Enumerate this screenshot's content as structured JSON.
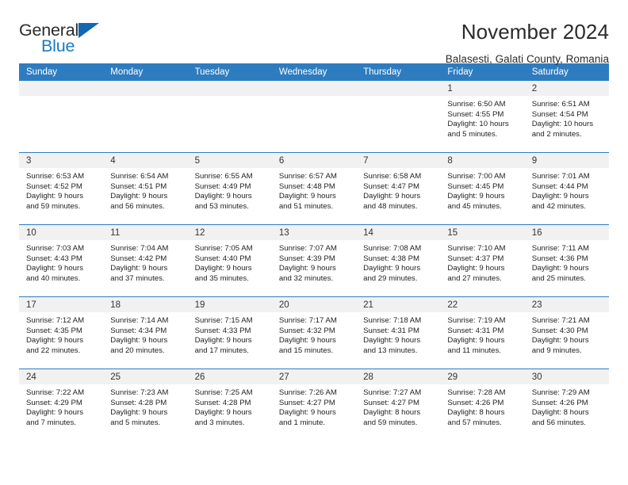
{
  "brand": {
    "name_top": "General",
    "name_bottom": "Blue",
    "accent_color": "#1167b1",
    "blue_text_color": "#1a7ac4"
  },
  "header": {
    "title": "November 2024",
    "subtitle": "Balasesti, Galati County, Romania"
  },
  "calendar": {
    "header_bg": "#2e7cc0",
    "daynum_bg": "#f1f1f1",
    "weekday_headers": [
      "Sunday",
      "Monday",
      "Tuesday",
      "Wednesday",
      "Thursday",
      "Friday",
      "Saturday"
    ],
    "weeks": [
      [
        {
          "day": "",
          "empty": true
        },
        {
          "day": "",
          "empty": true
        },
        {
          "day": "",
          "empty": true
        },
        {
          "day": "",
          "empty": true
        },
        {
          "day": "",
          "empty": true
        },
        {
          "day": "1",
          "sunrise": "Sunrise: 6:50 AM",
          "sunset": "Sunset: 4:55 PM",
          "daylight_1": "Daylight: 10 hours",
          "daylight_2": "and 5 minutes."
        },
        {
          "day": "2",
          "sunrise": "Sunrise: 6:51 AM",
          "sunset": "Sunset: 4:54 PM",
          "daylight_1": "Daylight: 10 hours",
          "daylight_2": "and 2 minutes."
        }
      ],
      [
        {
          "day": "3",
          "sunrise": "Sunrise: 6:53 AM",
          "sunset": "Sunset: 4:52 PM",
          "daylight_1": "Daylight: 9 hours",
          "daylight_2": "and 59 minutes."
        },
        {
          "day": "4",
          "sunrise": "Sunrise: 6:54 AM",
          "sunset": "Sunset: 4:51 PM",
          "daylight_1": "Daylight: 9 hours",
          "daylight_2": "and 56 minutes."
        },
        {
          "day": "5",
          "sunrise": "Sunrise: 6:55 AM",
          "sunset": "Sunset: 4:49 PM",
          "daylight_1": "Daylight: 9 hours",
          "daylight_2": "and 53 minutes."
        },
        {
          "day": "6",
          "sunrise": "Sunrise: 6:57 AM",
          "sunset": "Sunset: 4:48 PM",
          "daylight_1": "Daylight: 9 hours",
          "daylight_2": "and 51 minutes."
        },
        {
          "day": "7",
          "sunrise": "Sunrise: 6:58 AM",
          "sunset": "Sunset: 4:47 PM",
          "daylight_1": "Daylight: 9 hours",
          "daylight_2": "and 48 minutes."
        },
        {
          "day": "8",
          "sunrise": "Sunrise: 7:00 AM",
          "sunset": "Sunset: 4:45 PM",
          "daylight_1": "Daylight: 9 hours",
          "daylight_2": "and 45 minutes."
        },
        {
          "day": "9",
          "sunrise": "Sunrise: 7:01 AM",
          "sunset": "Sunset: 4:44 PM",
          "daylight_1": "Daylight: 9 hours",
          "daylight_2": "and 42 minutes."
        }
      ],
      [
        {
          "day": "10",
          "sunrise": "Sunrise: 7:03 AM",
          "sunset": "Sunset: 4:43 PM",
          "daylight_1": "Daylight: 9 hours",
          "daylight_2": "and 40 minutes."
        },
        {
          "day": "11",
          "sunrise": "Sunrise: 7:04 AM",
          "sunset": "Sunset: 4:42 PM",
          "daylight_1": "Daylight: 9 hours",
          "daylight_2": "and 37 minutes."
        },
        {
          "day": "12",
          "sunrise": "Sunrise: 7:05 AM",
          "sunset": "Sunset: 4:40 PM",
          "daylight_1": "Daylight: 9 hours",
          "daylight_2": "and 35 minutes."
        },
        {
          "day": "13",
          "sunrise": "Sunrise: 7:07 AM",
          "sunset": "Sunset: 4:39 PM",
          "daylight_1": "Daylight: 9 hours",
          "daylight_2": "and 32 minutes."
        },
        {
          "day": "14",
          "sunrise": "Sunrise: 7:08 AM",
          "sunset": "Sunset: 4:38 PM",
          "daylight_1": "Daylight: 9 hours",
          "daylight_2": "and 29 minutes."
        },
        {
          "day": "15",
          "sunrise": "Sunrise: 7:10 AM",
          "sunset": "Sunset: 4:37 PM",
          "daylight_1": "Daylight: 9 hours",
          "daylight_2": "and 27 minutes."
        },
        {
          "day": "16",
          "sunrise": "Sunrise: 7:11 AM",
          "sunset": "Sunset: 4:36 PM",
          "daylight_1": "Daylight: 9 hours",
          "daylight_2": "and 25 minutes."
        }
      ],
      [
        {
          "day": "17",
          "sunrise": "Sunrise: 7:12 AM",
          "sunset": "Sunset: 4:35 PM",
          "daylight_1": "Daylight: 9 hours",
          "daylight_2": "and 22 minutes."
        },
        {
          "day": "18",
          "sunrise": "Sunrise: 7:14 AM",
          "sunset": "Sunset: 4:34 PM",
          "daylight_1": "Daylight: 9 hours",
          "daylight_2": "and 20 minutes."
        },
        {
          "day": "19",
          "sunrise": "Sunrise: 7:15 AM",
          "sunset": "Sunset: 4:33 PM",
          "daylight_1": "Daylight: 9 hours",
          "daylight_2": "and 17 minutes."
        },
        {
          "day": "20",
          "sunrise": "Sunrise: 7:17 AM",
          "sunset": "Sunset: 4:32 PM",
          "daylight_1": "Daylight: 9 hours",
          "daylight_2": "and 15 minutes."
        },
        {
          "day": "21",
          "sunrise": "Sunrise: 7:18 AM",
          "sunset": "Sunset: 4:31 PM",
          "daylight_1": "Daylight: 9 hours",
          "daylight_2": "and 13 minutes."
        },
        {
          "day": "22",
          "sunrise": "Sunrise: 7:19 AM",
          "sunset": "Sunset: 4:31 PM",
          "daylight_1": "Daylight: 9 hours",
          "daylight_2": "and 11 minutes."
        },
        {
          "day": "23",
          "sunrise": "Sunrise: 7:21 AM",
          "sunset": "Sunset: 4:30 PM",
          "daylight_1": "Daylight: 9 hours",
          "daylight_2": "and 9 minutes."
        }
      ],
      [
        {
          "day": "24",
          "sunrise": "Sunrise: 7:22 AM",
          "sunset": "Sunset: 4:29 PM",
          "daylight_1": "Daylight: 9 hours",
          "daylight_2": "and 7 minutes."
        },
        {
          "day": "25",
          "sunrise": "Sunrise: 7:23 AM",
          "sunset": "Sunset: 4:28 PM",
          "daylight_1": "Daylight: 9 hours",
          "daylight_2": "and 5 minutes."
        },
        {
          "day": "26",
          "sunrise": "Sunrise: 7:25 AM",
          "sunset": "Sunset: 4:28 PM",
          "daylight_1": "Daylight: 9 hours",
          "daylight_2": "and 3 minutes."
        },
        {
          "day": "27",
          "sunrise": "Sunrise: 7:26 AM",
          "sunset": "Sunset: 4:27 PM",
          "daylight_1": "Daylight: 9 hours",
          "daylight_2": "and 1 minute."
        },
        {
          "day": "28",
          "sunrise": "Sunrise: 7:27 AM",
          "sunset": "Sunset: 4:27 PM",
          "daylight_1": "Daylight: 8 hours",
          "daylight_2": "and 59 minutes."
        },
        {
          "day": "29",
          "sunrise": "Sunrise: 7:28 AM",
          "sunset": "Sunset: 4:26 PM",
          "daylight_1": "Daylight: 8 hours",
          "daylight_2": "and 57 minutes."
        },
        {
          "day": "30",
          "sunrise": "Sunrise: 7:29 AM",
          "sunset": "Sunset: 4:26 PM",
          "daylight_1": "Daylight: 8 hours",
          "daylight_2": "and 56 minutes."
        }
      ]
    ]
  }
}
